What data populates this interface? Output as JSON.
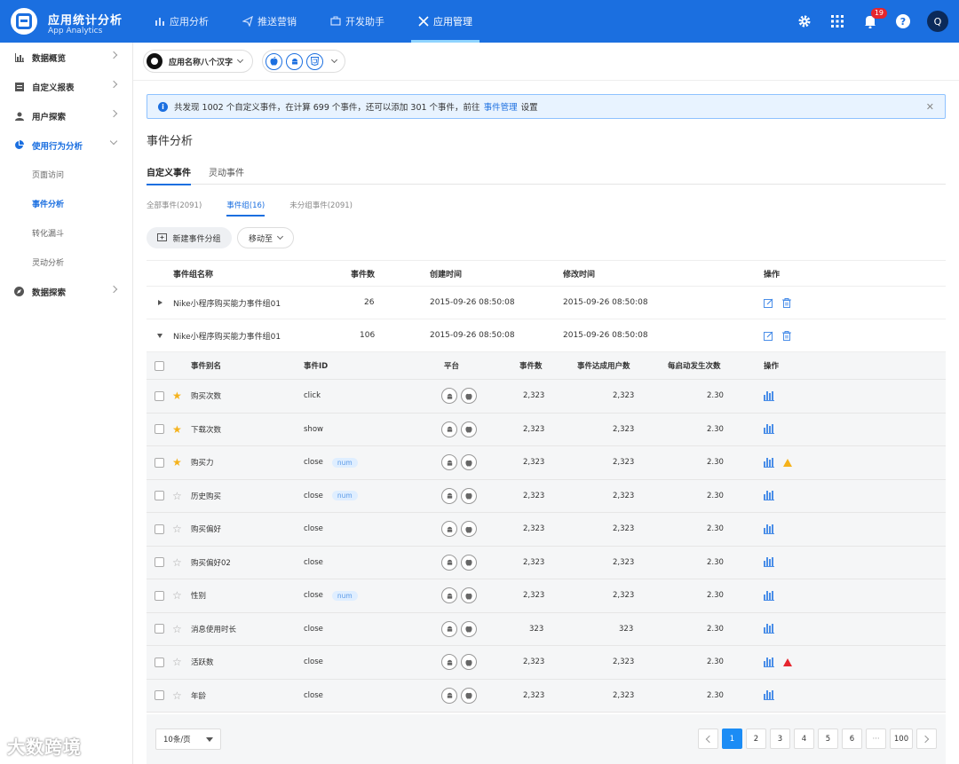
{
  "brand": {
    "title": "应用统计分析",
    "subtitle": "App Analytics"
  },
  "topnav": [
    {
      "label": "应用分析",
      "icon": "bar-chart-icon",
      "active": false
    },
    {
      "label": "推送营销",
      "icon": "send-icon",
      "active": false
    },
    {
      "label": "开发助手",
      "icon": "toolbox-icon",
      "active": false
    },
    {
      "label": "应用管理",
      "icon": "tools-icon",
      "active": true
    }
  ],
  "header": {
    "notification_count": "19",
    "avatar_letter": "Q"
  },
  "sidebar": {
    "items": [
      {
        "label": "数据概览",
        "icon": "chart-icon"
      },
      {
        "label": "自定义报表",
        "icon": "report-icon"
      },
      {
        "label": "用户探索",
        "icon": "user-icon"
      },
      {
        "label": "使用行为分析",
        "icon": "pie-icon"
      },
      {
        "label": "数据探索",
        "icon": "compass-icon"
      }
    ],
    "sub_items": [
      {
        "label": "页面访问"
      },
      {
        "label": "事件分析"
      },
      {
        "label": "转化漏斗"
      },
      {
        "label": "灵动分析"
      }
    ]
  },
  "watermark": "大数跨境",
  "appbar": {
    "app_name": "应用名称八个汉字"
  },
  "alert": {
    "text_before": "共发现 1002 个自定义事件，在计算 699 个事件，还可以添加 301 个事件，前往",
    "link": "事件管理",
    "text_after": "设置"
  },
  "page_title": "事件分析",
  "tabs1": [
    "自定义事件",
    "灵动事件"
  ],
  "tabs2": [
    "全部事件(2091)",
    "事件组(16)",
    "未分组事件(2091)"
  ],
  "actions": {
    "new_group": "新建事件分组",
    "move_to": "移动至"
  },
  "group_table": {
    "headers": [
      "事件组名称",
      "事件数",
      "创建时间",
      "修改时间",
      "操作"
    ],
    "rows": [
      {
        "name": "Nike小程序购买能力事件组01",
        "count": "26",
        "created": "2015-09-26 08:50:08",
        "modified": "2015-09-26 08:50:08"
      },
      {
        "name": "Nike小程序购买能力事件组01",
        "count": "106",
        "created": "2015-09-26 08:50:08",
        "modified": "2015-09-26 08:50:08"
      }
    ]
  },
  "event_table": {
    "headers": [
      "事件别名",
      "事件ID",
      "平台",
      "事件数",
      "事件达成用户数",
      "每启动发生次数",
      "操作"
    ],
    "rows": [
      {
        "alias": "购买次数",
        "id": "click",
        "tag": "",
        "events": "2,323",
        "users": "2,323",
        "per_launch": "2.30",
        "starred": true,
        "warn": ""
      },
      {
        "alias": "下载次数",
        "id": "show",
        "tag": "",
        "events": "2,323",
        "users": "2,323",
        "per_launch": "2.30",
        "starred": true,
        "warn": ""
      },
      {
        "alias": "购买力",
        "id": "close",
        "tag": "num",
        "events": "2,323",
        "users": "2,323",
        "per_launch": "2.30",
        "starred": true,
        "warn": "yellow"
      },
      {
        "alias": "历史购买",
        "id": "close",
        "tag": "num",
        "events": "2,323",
        "users": "2,323",
        "per_launch": "2.30",
        "starred": false,
        "warn": ""
      },
      {
        "alias": "购买偏好",
        "id": "close",
        "tag": "",
        "events": "2,323",
        "users": "2,323",
        "per_launch": "2.30",
        "starred": false,
        "warn": ""
      },
      {
        "alias": "购买偏好02",
        "id": "close",
        "tag": "",
        "events": "2,323",
        "users": "2,323",
        "per_launch": "2.30",
        "starred": false,
        "warn": ""
      },
      {
        "alias": "性别",
        "id": "close",
        "tag": "num",
        "events": "2,323",
        "users": "2,323",
        "per_launch": "2.30",
        "starred": false,
        "warn": ""
      },
      {
        "alias": "消息使用时长",
        "id": "close",
        "tag": "",
        "events": "323",
        "users": "323",
        "per_launch": "2.30",
        "starred": false,
        "warn": ""
      },
      {
        "alias": "活跃数",
        "id": "close",
        "tag": "",
        "events": "2,323",
        "users": "2,323",
        "per_launch": "2.30",
        "starred": false,
        "warn": "red"
      },
      {
        "alias": "年龄",
        "id": "close",
        "tag": "",
        "events": "2,323",
        "users": "2,323",
        "per_launch": "2.30",
        "starred": false,
        "warn": ""
      }
    ]
  },
  "pagination": {
    "page_size": "10条/页",
    "pages": [
      "1",
      "2",
      "3",
      "4",
      "5",
      "6",
      "···",
      "100"
    ],
    "current": "1"
  },
  "colors": {
    "primary": "#1b6fe0",
    "star": "#f5b21b",
    "danger": "#e6262e"
  }
}
